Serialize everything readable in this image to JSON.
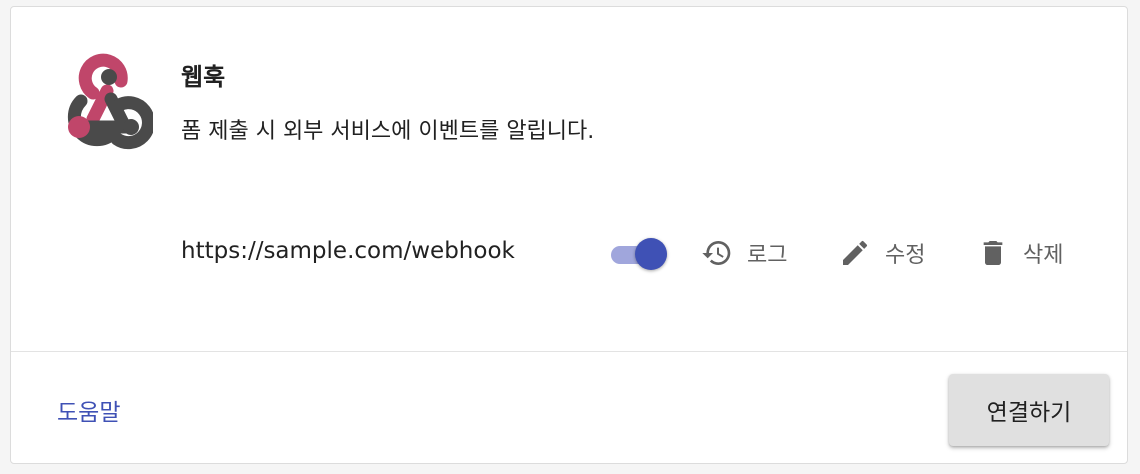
{
  "integration": {
    "title": "웹훅",
    "description": "폼 제출 시 외부 서비스에 이벤트를 알립니다.",
    "logo_icon": "webhook-logo",
    "url": "https://sample.com/webhook",
    "enabled": true
  },
  "actions": [
    {
      "label": "로그",
      "icon": "history-icon"
    },
    {
      "label": "수정",
      "icon": "pencil-icon"
    },
    {
      "label": "삭제",
      "icon": "trash-icon"
    }
  ],
  "footer": {
    "help_label": "도움말",
    "connect_label": "연결하기"
  },
  "colors": {
    "accent": "#3f51b5",
    "toggle_track": "#a0a6dc",
    "logo_red": "#c0466a",
    "logo_gray": "#4a4a4a",
    "button_bg": "#e0e0e0"
  }
}
